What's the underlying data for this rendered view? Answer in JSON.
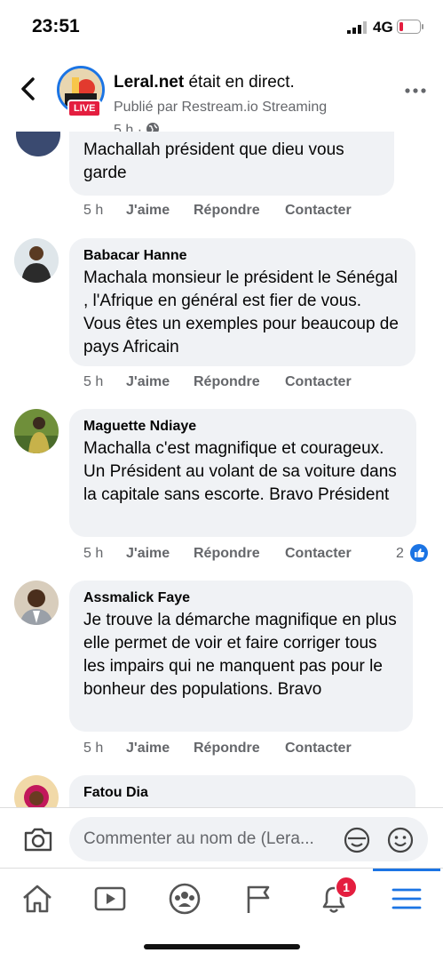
{
  "status_bar": {
    "time": "23:51",
    "network": "4G"
  },
  "header": {
    "page_name": "Leral.net",
    "title_suffix": " était en direct.",
    "subtitle": "Publié par Restream.io Streaming",
    "time": "5 h ·",
    "live_label": "LIVE"
  },
  "actions": {
    "like": "J'aime",
    "reply": "Répondre",
    "contact": "Contacter"
  },
  "comments": [
    {
      "author": "",
      "text_line1": "Machallah président que dieu vous",
      "text_line2": "garde",
      "time": "5 h"
    },
    {
      "author": "Babacar Hanne",
      "text": "Machala monsieur le président le Sénégal , l'Afrique en général est fier de vous. Vous êtes un exemples pour beaucoup de pays Africain",
      "time": "5 h"
    },
    {
      "author": "Maguette Ndiaye",
      "text": "Machalla c'est magnifique et courageux. Un Président au volant de sa voiture dans la capitale sans escorte.  Bravo Président",
      "time": "5 h",
      "reactions": "2"
    },
    {
      "author": "Assmalick Faye",
      "text": "Je trouve la démarche magnifique en plus elle permet de voir et faire corriger tous les impairs qui ne manquent pas pour le bonheur des populations. Bravo",
      "time": "5 h"
    },
    {
      "author": "Fatou Dia"
    }
  ],
  "composer": {
    "placeholder": "Commenter au nom de (Lera..."
  },
  "nav": {
    "notifications_badge": "1"
  },
  "colors": {
    "accent": "#1b74e4",
    "badge": "#e41e3f",
    "bubble": "#f0f2f5"
  }
}
